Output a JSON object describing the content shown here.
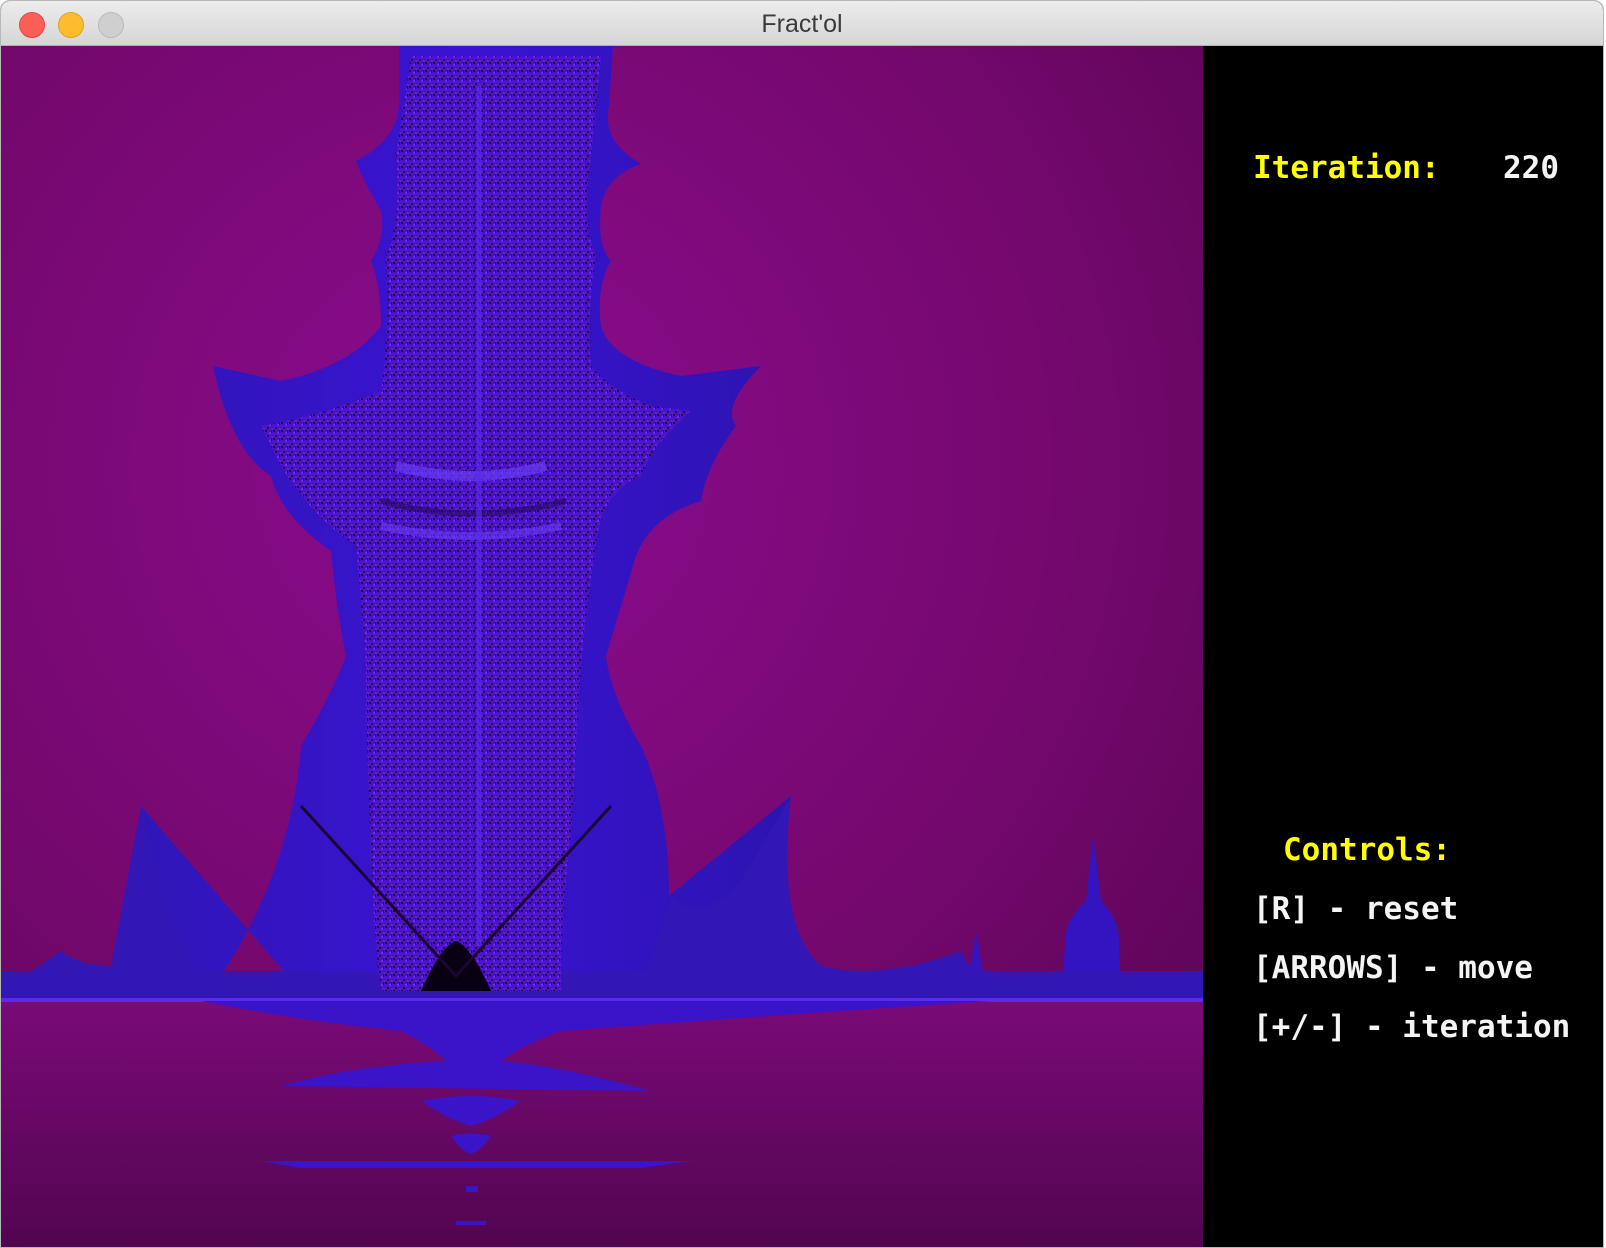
{
  "window": {
    "title": "Fract'ol"
  },
  "panel": {
    "iteration_label": "Iteration:",
    "iteration_value": "220",
    "controls_title": "Controls:",
    "controls": [
      "[R] - reset",
      "[ARROWS] - move",
      "[+/-] - iteration"
    ]
  },
  "colors": {
    "label_yellow": "#ffff00",
    "text_white": "#f4f4f4",
    "fractal_background": "#7a0a7a",
    "fractal_body": "#3a10c8",
    "panel_background": "#000000"
  }
}
